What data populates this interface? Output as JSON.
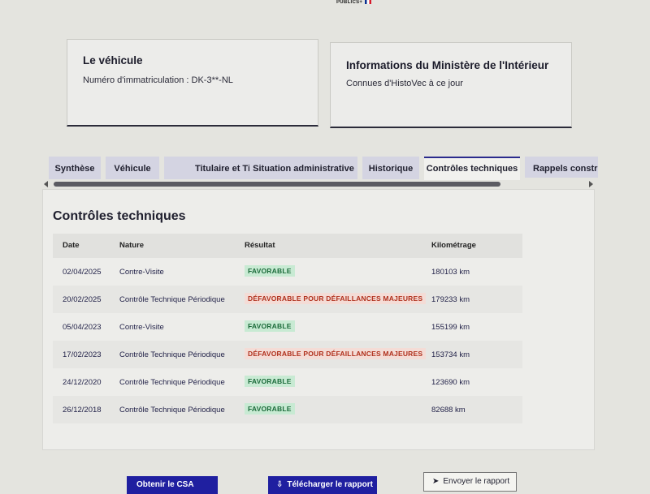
{
  "header": {
    "logo_text": "PUBLICS+"
  },
  "vehicle_card": {
    "title": "Le véhicule",
    "plate_line": "Numéro d'immatriculation : DK-3**-NL"
  },
  "ministere_card": {
    "title": "Informations du Ministère de l'Intérieur",
    "subtitle": "Connues d'HistoVec à ce jour"
  },
  "tabs": [
    {
      "label": "Synthèse",
      "active": false
    },
    {
      "label": "Véhicule",
      "active": false
    },
    {
      "label": "Titulaire et Titre",
      "active": false
    },
    {
      "label": "Situation administrative",
      "active": false
    },
    {
      "label": "Historique",
      "active": false
    },
    {
      "label": "Contrôles techniques",
      "active": true
    },
    {
      "label": "Rappels constru",
      "active": false
    }
  ],
  "section": {
    "title": "Contrôles techniques",
    "columns": {
      "date": "Date",
      "nature": "Nature",
      "result": "Résultat",
      "mileage": "Kilométrage"
    },
    "rows": [
      {
        "date": "02/04/2025",
        "nature": "Contre-Visite",
        "result": "FAVORABLE",
        "status": "ok",
        "km": "180103 km"
      },
      {
        "date": "20/02/2025",
        "nature": "Contrôle Technique Périodique",
        "result": "DÉFAVORABLE POUR DÉFAILLANCES MAJEURES",
        "status": "ko",
        "km": "179233 km"
      },
      {
        "date": "05/04/2023",
        "nature": "Contre-Visite",
        "result": "FAVORABLE",
        "status": "ok",
        "km": "155199 km"
      },
      {
        "date": "17/02/2023",
        "nature": "Contrôle Technique Périodique",
        "result": "DÉFAVORABLE POUR DÉFAILLANCES MAJEURES",
        "status": "ko",
        "km": "153734 km"
      },
      {
        "date": "24/12/2020",
        "nature": "Contrôle Technique Périodique",
        "result": "FAVORABLE",
        "status": "ok",
        "km": "123690 km"
      },
      {
        "date": "26/12/2018",
        "nature": "Contrôle Technique Périodique",
        "result": "FAVORABLE",
        "status": "ok",
        "km": "82688 km"
      }
    ]
  },
  "actions": {
    "csa_label": "Obtenir le CSA",
    "download_label": "Télécharger le rapport",
    "send_label": "Envoyer le rapport"
  },
  "colors": {
    "primary": "#1f1fa0",
    "ok_bg": "#c8ead3",
    "ok_text": "#1b6b3a",
    "ko_bg": "#f4dcd6",
    "ko_text": "#b0301c"
  }
}
